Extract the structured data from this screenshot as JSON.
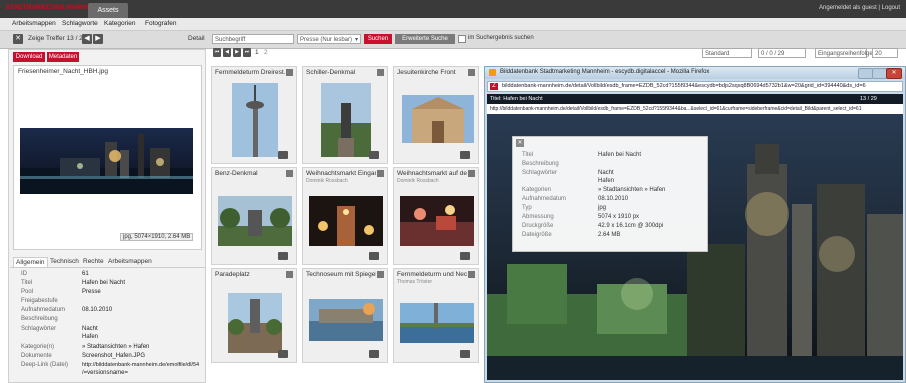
{
  "header": {
    "logo": "STADTMARKETING MANNHEIM",
    "tab": "Assets",
    "user": "Angemeldet als guest | Logout"
  },
  "nav": [
    "Arbeitsmappen",
    "Schlagworte",
    "Kategorien",
    "Fotografen"
  ],
  "toolbar": {
    "hits": "Zeige Treffer 13 / 29",
    "detail": "Detail",
    "search_placeholder": "Suchbegriff",
    "scope": "Presse (Nur lesbar)",
    "search_button": "Suchen",
    "ext_search_button": "Erweiterte Suche",
    "in_results": "im Suchergebnis suchen",
    "pages": [
      "1",
      "2"
    ],
    "sort": "Standard",
    "range": "0 / 0 / 29",
    "order": "Eingangsreihenfolge",
    "per_page": "20"
  },
  "left": {
    "download": "Download",
    "metadata": "Metadaten",
    "filename": "Friesenheimer_Nacht_HBH.jpg",
    "info": "jpg, 5074×1910, 2.64 MB",
    "tabs": [
      "Allgemein",
      "Technisch",
      "Rechte",
      "Arbeitsmappen"
    ],
    "props": [
      {
        "k": "ID",
        "v": "61"
      },
      {
        "k": "Titel",
        "v": "Hafen bei Nacht"
      },
      {
        "k": "Pool",
        "v": "Presse"
      },
      {
        "k": "Freigabestufe",
        "v": ""
      },
      {
        "k": "Aufnahmedatum",
        "v": "08.10.2010"
      },
      {
        "k": "Beschreibung",
        "v": ""
      },
      {
        "k": "Schlagwörter",
        "v": "Nacht"
      },
      {
        "k": "",
        "v": "Hafen"
      },
      {
        "k": "Kategorie(n)",
        "v": "» Stadtansichten » Hafen"
      },
      {
        "k": "Dokumente",
        "v": "Screenshot_Hafen.JPG"
      },
      {
        "k": "Deep-Link (Datei)",
        "v": "http://bilddatenbank-mannheim.de/emolfile/dl/54"
      },
      {
        "k": "",
        "v": "/=versionsname="
      }
    ]
  },
  "cards": [
    {
      "title": "Fernmeldeturm Dreirest.",
      "sub": ""
    },
    {
      "title": "Schiller-Denkmal",
      "sub": ""
    },
    {
      "title": "Jesuitenkirche Front",
      "sub": ""
    },
    {
      "title": "Benz-Denkmal",
      "sub": ""
    },
    {
      "title": "Weihnachtsmarkt Eingan",
      "sub": "Dominik Rossbach"
    },
    {
      "title": "Weihnachtsmarkt auf der",
      "sub": "Dominik Rossbach"
    },
    {
      "title": "Paradeplatz",
      "sub": ""
    },
    {
      "title": "Technoseum mit Spiegel",
      "sub": ""
    },
    {
      "title": "Fernmeldeturm und Neck",
      "sub": "Thomas Tröster"
    }
  ],
  "popup": {
    "title": "Bilddatenbank Stadtmarketing Mannheim - escydb.digitalaccel - Mozilla Firefox",
    "url": "bilddatenbank-mannheim.de/detail/Vollbild/esdb_frame=EZDB_52cd?155f9344&escydb=bdjs2sqsq8B0694d5732b1&w=20&grid_id=394440&ds_id=6",
    "inner_title": "Titel: Hafen bei Nacht",
    "inner_counter": "13 / 29",
    "inner_url": "http://bilddatenbank-mannheim.de/detail/Vollbild/esdb_frame=EZDB_52cd?155f9344&ba...&select_id=61&curframe=sideberframe&cid=detail_Bild&parent_select_id=61",
    "props": [
      {
        "k": "Titel",
        "v": "Hafen bei Nacht"
      },
      {
        "k": "Beschreibung",
        "v": ""
      },
      {
        "k": "Schlagwörter",
        "v": "Nacht"
      },
      {
        "k": "",
        "v": "Hafen"
      },
      {
        "k": "Kategorien",
        "v": "» Stadtansichten » Hafen"
      },
      {
        "k": "Aufnahmedatum",
        "v": "08.10.2010"
      },
      {
        "k": "Typ",
        "v": "jpg"
      },
      {
        "k": "Abmessung",
        "v": "5074 x 1910 px"
      },
      {
        "k": "Druckgröße",
        "v": "42.9 x 16.1cm @ 300dpi"
      },
      {
        "k": "Dateigröße",
        "v": "2.64 MB"
      }
    ]
  },
  "colors": {
    "accent": "#c8102e",
    "dark": "#3a3a3a"
  }
}
